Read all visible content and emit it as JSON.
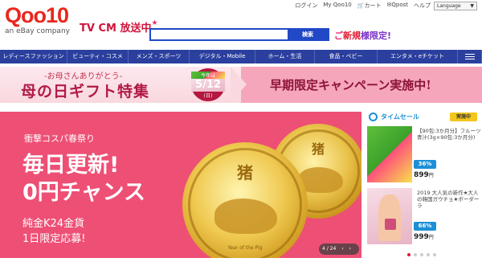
{
  "utility": {
    "login": "ログイン",
    "myqoo10": "My Qoo10",
    "cart": "カート",
    "qpost": "Qpost",
    "help": "ヘルプ",
    "language": "Language"
  },
  "logo": {
    "brand": "Qoo10",
    "sub": "an eBay company"
  },
  "tvcm": {
    "text": "TV CM 放送中",
    "star": "★"
  },
  "search": {
    "value": "",
    "button": "検索"
  },
  "promo": {
    "prefix": "ご",
    "new": "新規",
    "limited": "様限定!"
  },
  "categories": [
    {
      "label": "レディースファッション"
    },
    {
      "label": "ビューティ・コスメ"
    },
    {
      "label": "メンズ・スポーツ"
    },
    {
      "label": "デジタル・Mobile"
    },
    {
      "label": "ホーム・生活"
    },
    {
      "label": "食品・ベビー"
    },
    {
      "label": "エンタメ・eチケット"
    }
  ],
  "mothers_day": {
    "subtitle": "-お母さんありがとう-",
    "title": "母の日ギフト特集",
    "date_top": "今年は",
    "date": "5/12",
    "date_day": "(日)",
    "campaign": "早期限定キャンペーン実施中!"
  },
  "hero": {
    "festival": "衝撃コスパ春祭り",
    "line1": "毎日更新!",
    "line2": "0円チャンス",
    "line3": "純金K24金貨",
    "line4": "1日限定応募!",
    "coin_glyph": "猪",
    "coin_caption": "Year of the Pig",
    "pager": "4 / 24",
    "prev": "‹",
    "next": "›"
  },
  "timesale": {
    "title": "タイムセール",
    "status": "実施中",
    "items": [
      {
        "desc": "【90包:3か月分】フルーツ青汁(3g×90包:3か月分)",
        "discount": "36%",
        "price": "899",
        "currency": "円"
      },
      {
        "desc": "2019 大人気の新作★大人の韓国ガウチョ★ボーダーラ",
        "discount": "66%",
        "price": "999",
        "currency": "円"
      }
    ]
  },
  "colors": {
    "brand_red": "#e8281f",
    "nav_blue": "#2b3f9e",
    "search_blue": "#2148c5",
    "hero_pink": "#ee4f75",
    "timesale_blue": "#1c8fd6"
  }
}
